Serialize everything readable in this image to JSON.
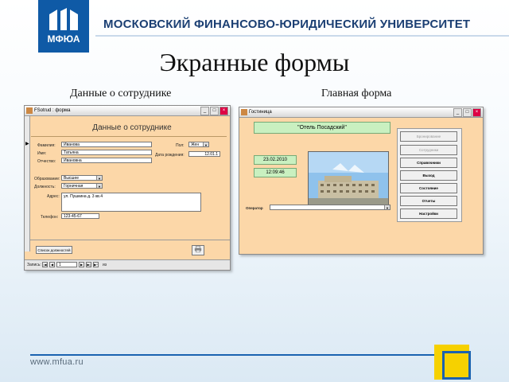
{
  "header": {
    "logo_text": "МФЮА",
    "university": "МОСКОВСКИЙ ФИНАНСОВО-ЮРИДИЧЕСКИЙ УНИВЕРСИТЕТ"
  },
  "title": "Экранные формы",
  "subtitles": {
    "left": "Данные о сотруднике",
    "right": "Главная форма"
  },
  "employee_form": {
    "window_title": "FSotrud : форма",
    "heading": "Данные о сотруднике",
    "labels": {
      "surname": "Фамилия:",
      "name": "Имя:",
      "patronymic": "Отчество:",
      "gender": "Пол:",
      "birthdate": "Дата рождения:",
      "education": "Образование:",
      "position": "Должность:",
      "address": "Адрес:",
      "phone": "Телефон:"
    },
    "values": {
      "surname": "Иванова",
      "name": "Татьяна",
      "patronymic": "Ивановна",
      "gender": "Жен",
      "birthdate": "12.01.1",
      "education": "Высшее",
      "position": "Горничная",
      "address": "ул. Пушкина д. 3 кв.4",
      "phone": "123-45-67"
    },
    "positions_button": "Список должностей",
    "nav": {
      "label": "Запись:",
      "record": "1",
      "of": "из"
    }
  },
  "main_form": {
    "window_title": "Гостиница",
    "hotel_name": "\"Отель Посадский\"",
    "date": "23.02.2010",
    "time": "12:09:46",
    "operator_label": "Оператор",
    "menu": [
      "Бронирование",
      "Сотрудники",
      "Справочники",
      "Выход",
      "Состояние",
      "Отчеты",
      "Настройки"
    ]
  },
  "footer": {
    "url": "www.mfua.ru"
  },
  "colors": {
    "brand_blue": "#0f5aa6",
    "form_bg": "#fcd7a8",
    "accent_yellow": "#f6d100"
  }
}
